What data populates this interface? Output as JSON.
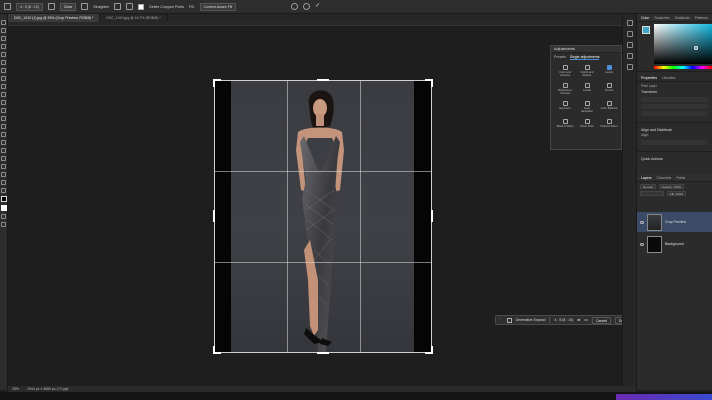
{
  "options_bar": {
    "ratio_select": "4 : 5 (8 : 10)",
    "clear_label": "Clear",
    "straighten_label": "Straighten",
    "delete_cropped_label": "Delete Cropped Pixels",
    "fill_label": "Fill:",
    "fill_value": "Content-Aware Fill"
  },
  "tabs": [
    {
      "label": "DSC_1410 (1).jpg @ 25% (Crop Preview, RGB/8) *"
    },
    {
      "label": "DSC_1410.jpg @ 16.7% (RGB/8) *"
    }
  ],
  "contextual_bar": {
    "generative_expand_label": "Generative Expand",
    "ratio_label": "4 : 5 (8 : 10)",
    "more_label": "•••",
    "cancel_label": "Cancel",
    "done_label": "Done"
  },
  "status_bar": {
    "zoom": "25%",
    "dimensions": "2944 px x 3680 px (72 ppi)"
  },
  "adjustments_panel": {
    "title": "Adjustments",
    "tab_presets": "Presets",
    "tab_single": "Single adjustments",
    "items": [
      {
        "label": "Color and vibrance"
      },
      {
        "label": "Clarity and dehaze"
      },
      {
        "label": "Levels"
      },
      {
        "label": "Brightness/ Contrast"
      },
      {
        "label": "Levels"
      },
      {
        "label": "Curves"
      },
      {
        "label": "Exposure"
      },
      {
        "label": "Hue/ Saturation"
      },
      {
        "label": "Color Balance"
      },
      {
        "label": "Black & White"
      },
      {
        "label": "Photo Filter"
      },
      {
        "label": "Channel Mixer"
      }
    ]
  },
  "color_panel": {
    "tab_color": "Color",
    "tab_swatches": "Swatches",
    "tab_gradients": "Gradients",
    "tab_patterns": "Patterns",
    "fg_color": "#3fa6c9"
  },
  "properties_panel": {
    "tab_properties": "Properties",
    "tab_libraries": "Libraries",
    "pixel_layer": "Pixel Layer",
    "transform": "Transform",
    "align_distribute": "Align and Distribute",
    "align": "Align:",
    "quick_actions": "Quick Actions"
  },
  "layers_panel": {
    "tab_layers": "Layers",
    "tab_channels": "Channels",
    "tab_paths": "Paths",
    "kind": "Normal",
    "opacity": "Opacity: 100%",
    "fill": "Fill: 100%",
    "layers": [
      {
        "name": "Crop Preview",
        "selected": true
      },
      {
        "name": "Background",
        "selected": false
      }
    ]
  },
  "accent_color": "#4d8fd6"
}
